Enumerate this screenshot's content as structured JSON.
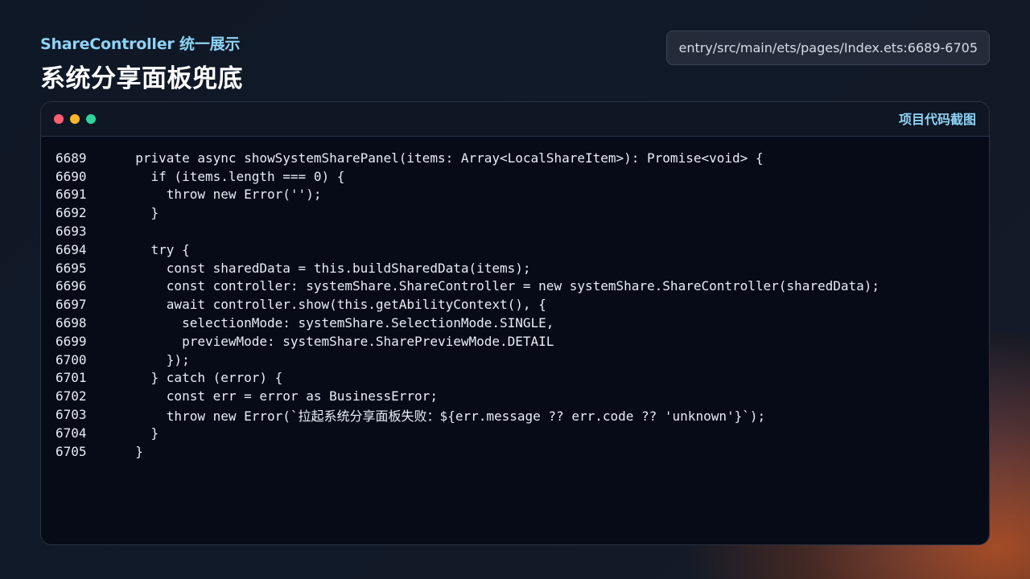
{
  "header": {
    "kicker": "ShareController 统一展示",
    "title": "系统分享面板兜底",
    "path": "entry/src/main/ets/pages/Index.ets:6689-6705"
  },
  "window": {
    "label": "项目代码截图",
    "dots": [
      "red",
      "yellow",
      "green"
    ],
    "colors": {
      "red": "#ff5f72",
      "yellow": "#f8b72a",
      "green": "#2ed39a",
      "accent": "#8fd3f5"
    }
  },
  "code": {
    "lines": [
      {
        "num": "6689",
        "text": "  private async showSystemSharePanel(items: Array<LocalShareItem>): Promise<void> {"
      },
      {
        "num": "6690",
        "text": "    if (items.length === 0) {"
      },
      {
        "num": "6691",
        "text": "      throw new Error('');"
      },
      {
        "num": "6692",
        "text": "    }"
      },
      {
        "num": "6693",
        "text": ""
      },
      {
        "num": "6694",
        "text": "    try {"
      },
      {
        "num": "6695",
        "text": "      const sharedData = this.buildSharedData(items);"
      },
      {
        "num": "6696",
        "text": "      const controller: systemShare.ShareController = new systemShare.ShareController(sharedData);"
      },
      {
        "num": "6697",
        "text": "      await controller.show(this.getAbilityContext(), {"
      },
      {
        "num": "6698",
        "text": "        selectionMode: systemShare.SelectionMode.SINGLE,"
      },
      {
        "num": "6699",
        "text": "        previewMode: systemShare.SharePreviewMode.DETAIL"
      },
      {
        "num": "6700",
        "text": "      });"
      },
      {
        "num": "6701",
        "text": "    } catch (error) {"
      },
      {
        "num": "6702",
        "text": "      const err = error as BusinessError;"
      },
      {
        "num": "6703",
        "text": "      throw new Error(`拉起系统分享面板失败：${err.message ?? err.code ?? 'unknown'}`);"
      },
      {
        "num": "6704",
        "text": "    }"
      },
      {
        "num": "6705",
        "text": "  }"
      }
    ]
  }
}
